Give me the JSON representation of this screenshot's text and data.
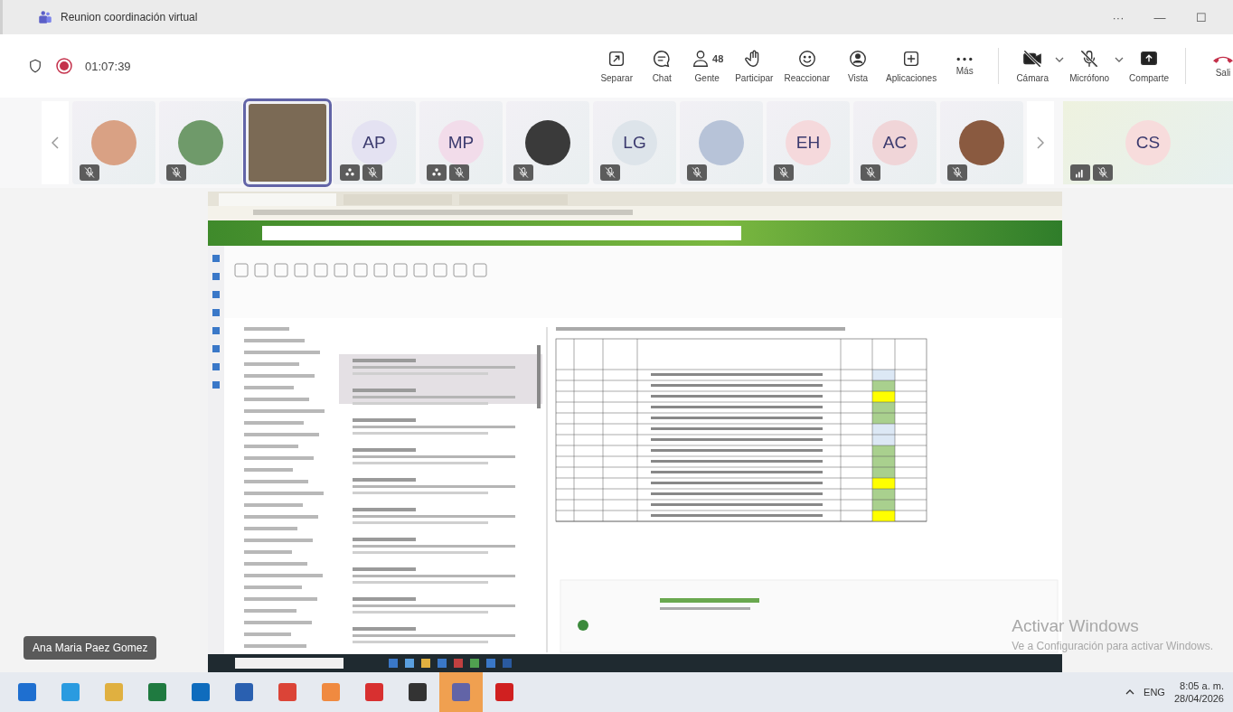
{
  "window": {
    "title": "Reunion coordinación virtual",
    "controls": [
      "···",
      "—",
      "☐"
    ]
  },
  "meeting_bar": {
    "timer": "01:07:39",
    "recording": true,
    "actions": [
      {
        "kind": "separate",
        "label": "Separar"
      },
      {
        "kind": "chat",
        "label": "Chat"
      },
      {
        "kind": "people",
        "label": "Gente",
        "count": "48"
      },
      {
        "kind": "hand",
        "label": "Participar"
      },
      {
        "kind": "react",
        "label": "Reaccionar"
      },
      {
        "kind": "view",
        "label": "Vista"
      },
      {
        "kind": "apps",
        "label": "Aplicaciones"
      },
      {
        "kind": "more",
        "label": "Más"
      }
    ],
    "devices": [
      {
        "kind": "camera",
        "label": "Cámara",
        "off": true
      },
      {
        "kind": "mic",
        "label": "Micrófono",
        "off": true
      },
      {
        "kind": "share",
        "label": "Comparte"
      }
    ],
    "leave": {
      "label": "Sali"
    }
  },
  "participants": [
    {
      "kind": "photo",
      "speaking": false,
      "muted": true,
      "grouped": false,
      "color": "#d9a184"
    },
    {
      "kind": "photo",
      "speaking": false,
      "muted": true,
      "grouped": false,
      "color": "#6f9a6a"
    },
    {
      "kind": "video",
      "speaking": true,
      "muted": false,
      "grouped": false,
      "color": "#7b6a55"
    },
    {
      "kind": "initials",
      "initials": "AP",
      "speaking": false,
      "muted": true,
      "grouped": true,
      "color": "#e4e2f2"
    },
    {
      "kind": "initials",
      "initials": "MP",
      "speaking": false,
      "muted": true,
      "grouped": true,
      "color": "#f2dcea"
    },
    {
      "kind": "photo",
      "speaking": false,
      "muted": true,
      "grouped": false,
      "color": "#3a3a3a"
    },
    {
      "kind": "initials",
      "initials": "LG",
      "speaking": false,
      "muted": true,
      "grouped": false,
      "color": "#dde4ea"
    },
    {
      "kind": "photo",
      "speaking": false,
      "muted": true,
      "grouped": false,
      "color": "#b7c3d8"
    },
    {
      "kind": "initials",
      "initials": "EH",
      "speaking": false,
      "muted": true,
      "grouped": false,
      "color": "#f5d9dc"
    },
    {
      "kind": "initials",
      "initials": "AC",
      "speaking": false,
      "muted": true,
      "grouped": false,
      "color": "#f0d5d8"
    },
    {
      "kind": "photo",
      "speaking": false,
      "muted": true,
      "grouped": false,
      "color": "#8a5a40"
    }
  ],
  "pinned": {
    "initials": "CS",
    "muted": true,
    "signal": true,
    "color": "#f7dcdc"
  },
  "presenter": {
    "name": "Ana Maria Paez Gomez"
  },
  "activation": {
    "title": "Activar Windows",
    "message": "Ve a Configuración para activar Windows."
  },
  "taskbar": {
    "apps": [
      {
        "selected": false
      },
      {
        "selected": false
      },
      {
        "selected": false
      },
      {
        "selected": false
      },
      {
        "selected": false
      },
      {
        "selected": false
      },
      {
        "selected": false
      },
      {
        "selected": false
      },
      {
        "selected": false
      },
      {
        "selected": false
      },
      {
        "selected": true
      },
      {
        "selected": false
      }
    ],
    "language": "ENG",
    "time": "8:05 a. m.",
    "date": "28/04/2026"
  }
}
